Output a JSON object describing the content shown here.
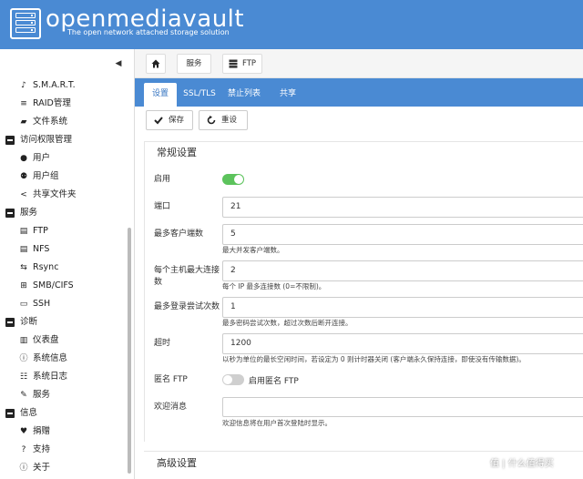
{
  "header": {
    "logo_text": "openmediavault",
    "tagline": "The open network attached storage solution",
    "brand_color": "#4a8ad3"
  },
  "sidebar": {
    "toggle_icon": "chevron-left-icon",
    "items": [
      {
        "label": "S.M.A.R.T.",
        "icon": "smart-icon",
        "level": 1
      },
      {
        "label": "RAID管理",
        "icon": "database-icon",
        "level": 1
      },
      {
        "label": "文件系统",
        "icon": "folder-icon",
        "level": 1
      },
      {
        "label": "访问权限管理",
        "icon": "minus-box-icon",
        "level": 0
      },
      {
        "label": "用户",
        "icon": "user-icon",
        "level": 1
      },
      {
        "label": "用户组",
        "icon": "users-icon",
        "level": 1
      },
      {
        "label": "共享文件夹",
        "icon": "share-icon",
        "level": 1
      },
      {
        "label": "服务",
        "icon": "minus-box-icon",
        "level": 0
      },
      {
        "label": "FTP",
        "icon": "server-icon",
        "level": 1
      },
      {
        "label": "NFS",
        "icon": "server-icon",
        "level": 1
      },
      {
        "label": "Rsync",
        "icon": "rsync-icon",
        "level": 1
      },
      {
        "label": "SMB/CIFS",
        "icon": "windows-icon",
        "level": 1
      },
      {
        "label": "SSH",
        "icon": "terminal-icon",
        "level": 1
      },
      {
        "label": "诊断",
        "icon": "minus-box-icon",
        "level": 0
      },
      {
        "label": "仪表盘",
        "icon": "dashboard-icon",
        "level": 1
      },
      {
        "label": "系统信息",
        "icon": "info-icon",
        "level": 1
      },
      {
        "label": "系统日志",
        "icon": "list-icon",
        "level": 1
      },
      {
        "label": "服务",
        "icon": "wrench-icon",
        "level": 1
      },
      {
        "label": "信息",
        "icon": "minus-box-icon",
        "level": 0
      },
      {
        "label": "捐赠",
        "icon": "heart-icon",
        "level": 1
      },
      {
        "label": "支持",
        "icon": "question-icon",
        "level": 1
      },
      {
        "label": "关于",
        "icon": "info-icon",
        "level": 1
      }
    ]
  },
  "breadcrumb": {
    "home_icon": "home-icon",
    "services": "服务",
    "ftp": "FTP"
  },
  "tabs": [
    {
      "label": "设置",
      "active": true
    },
    {
      "label": "SSL/TLS",
      "active": false
    },
    {
      "label": "禁止列表",
      "active": false
    },
    {
      "label": "共享",
      "active": false
    }
  ],
  "actions": {
    "save": "保存",
    "reset": "重设"
  },
  "form": {
    "section_title": "常规设置",
    "enable_label": "启用",
    "enable_on": true,
    "port_label": "端口",
    "port_value": "21",
    "max_clients_label": "最多客户端数",
    "max_clients_value": "5",
    "max_clients_hint": "最大并发客户端数。",
    "max_per_host_label": "每个主机最大连接数",
    "max_per_host_value": "2",
    "max_per_host_hint": "每个 IP 最多连接数 (0=不限制)。",
    "max_login_label": "最多登录尝试次数",
    "max_login_value": "1",
    "max_login_hint": "最多密码尝试次数，超过次数后断开连接。",
    "timeout_label": "超时",
    "timeout_value": "1200",
    "timeout_hint": "以秒为单位的最长空闲时间，若设定为 0 则计时器关闭 (客户端永久保持连接，即使没有传输数据)。",
    "anon_label": "匿名 FTP",
    "anon_on": false,
    "anon_toggle_label": "启用匿名 FTP",
    "welcome_label": "欢迎消息",
    "welcome_value": "",
    "welcome_hint": "欢迎信息将在用户首次登陆时显示。",
    "advanced_title": "高级设置"
  },
  "watermark": "值 | 什么值得买"
}
